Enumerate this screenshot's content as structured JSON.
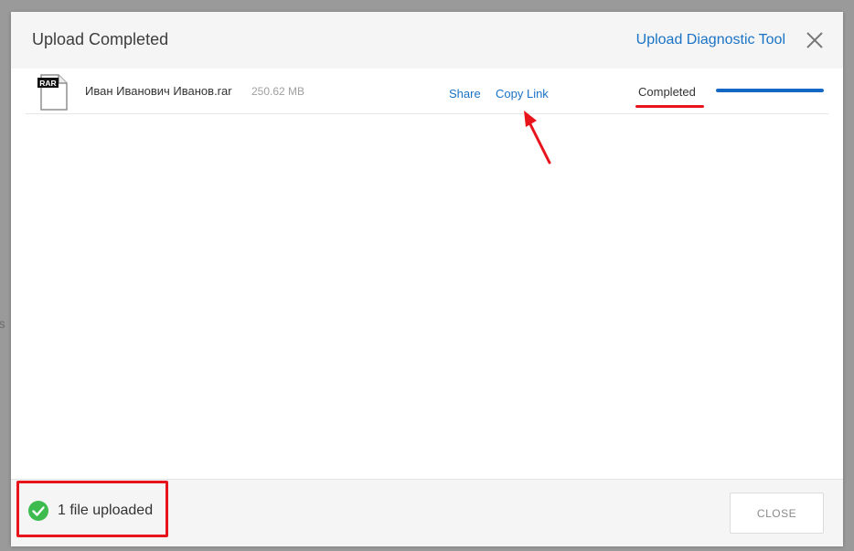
{
  "backdrop": {
    "fragment_text": "rs"
  },
  "dialog": {
    "title": "Upload Completed",
    "diagnostic_link": "Upload Diagnostic Tool"
  },
  "file": {
    "icon": "rar-file-icon",
    "type_badge": "RAR",
    "name": "Иван Иванович Иванов.rar",
    "size": "250.62 MB",
    "share_label": "Share",
    "copy_link_label": "Copy Link",
    "status": "Completed",
    "progress_percent": 100
  },
  "footer": {
    "status_icon": "check-circle-icon",
    "uploaded_text": "1 file uploaded",
    "close_label": "CLOSE"
  },
  "colors": {
    "accent": "#1a73c5",
    "progress": "#1468c4",
    "success": "#3dbb4f",
    "annotation": "#e8141b"
  }
}
